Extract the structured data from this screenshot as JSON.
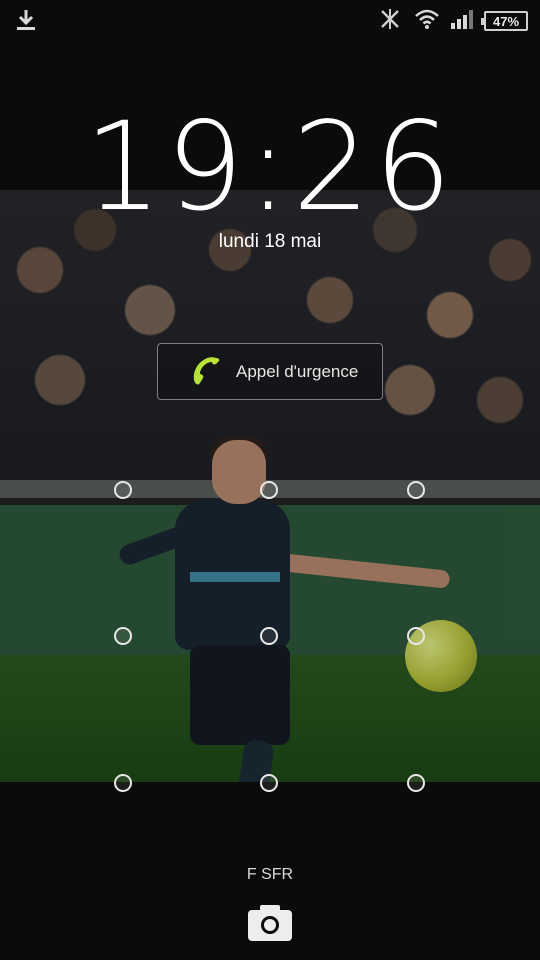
{
  "status_bar": {
    "battery_percent": "47%",
    "icons": [
      "download-icon",
      "nfc-off-icon",
      "wifi-icon",
      "cell-signal-icon",
      "battery-icon"
    ]
  },
  "lockscreen": {
    "time": "19:26",
    "date": "lundi 18 mai",
    "emergency_call_label": "Appel d'urgence",
    "carrier": "F SFR",
    "pattern_grid": {
      "rows": 3,
      "cols": 3
    }
  },
  "colors": {
    "background": "#0b0b0b",
    "phone_icon": "#b7e23a",
    "text": "#ffffff"
  }
}
